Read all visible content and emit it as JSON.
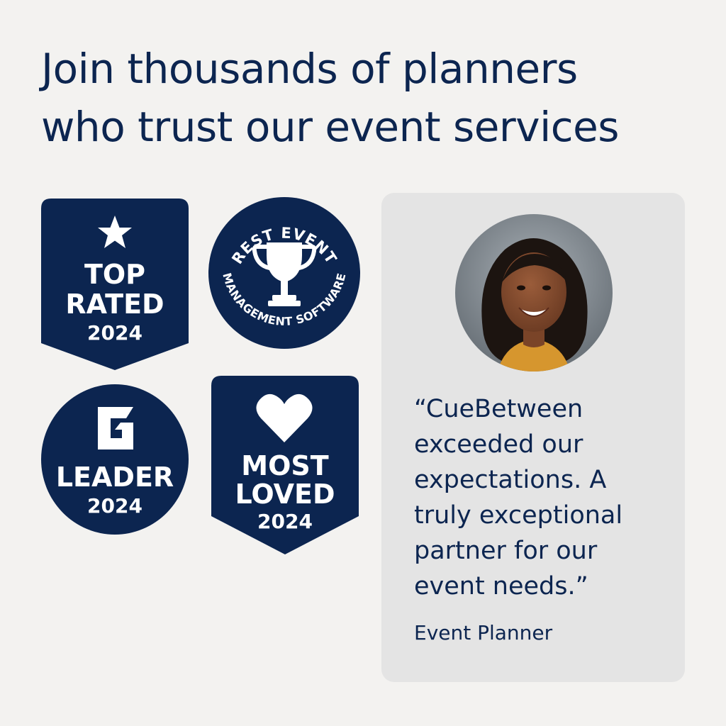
{
  "headline": {
    "line1": "Join thousands of planners",
    "line2": "who trust our event services"
  },
  "badges": {
    "top_rated": {
      "line1": "TOP",
      "line2": "RATED",
      "year": "2024",
      "icon": "star-icon"
    },
    "best_event": {
      "arc_top": "REST EVENT",
      "arc_bottom": "MANAGEMENT SOFTWARE",
      "icon": "trophy-icon"
    },
    "leader": {
      "logo": "G",
      "label": "LEADER",
      "year": "2024",
      "icon": "g-logo"
    },
    "most_loved": {
      "line1": "MOST",
      "line2": "LOVED",
      "year": "2024",
      "icon": "heart-icon"
    }
  },
  "testimonial": {
    "quote_lines": [
      "“CueBetween",
      "exceeded our",
      "expectations. A",
      "truly exceptional",
      "partner for our",
      "event needs.”"
    ],
    "author": "Event Planner"
  },
  "colors": {
    "navy": "#0c2550",
    "page_bg": "#f3f2f0",
    "card_bg": "#e4e4e4",
    "white": "#ffffff"
  }
}
